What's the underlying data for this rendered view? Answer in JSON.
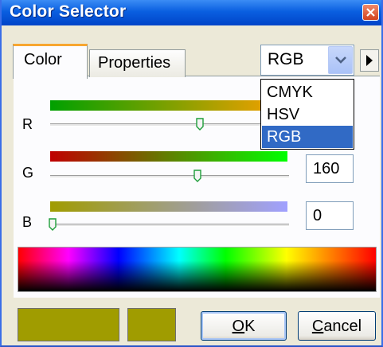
{
  "window": {
    "title": "Color Selector"
  },
  "tabs": [
    {
      "label": "Color",
      "active": true
    },
    {
      "label": "Properties",
      "active": false
    }
  ],
  "mode_select": {
    "value": "RGB",
    "options": [
      "CMYK",
      "HSV",
      "RGB"
    ],
    "selected_option": "RGB"
  },
  "channels": [
    {
      "label": "R",
      "value": "",
      "slider_fraction": 0.6
    },
    {
      "label": "G",
      "value": "160",
      "slider_fraction": 0.63
    },
    {
      "label": "B",
      "value": "0",
      "slider_fraction": 0.0
    }
  ],
  "colors": {
    "current": "#a09c00",
    "previous": "#a09c00",
    "title_bar": "#0a5fe0",
    "tab_accent": "#f7a630",
    "selection": "#316ac5"
  },
  "buttons": {
    "ok_underline": "O",
    "ok_rest": "K",
    "cancel_underline": "C",
    "cancel_rest": "ancel"
  }
}
